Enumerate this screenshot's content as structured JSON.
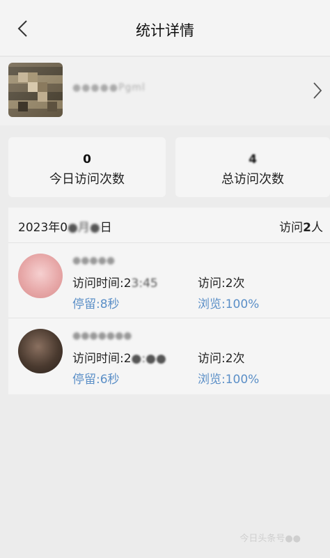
{
  "header": {
    "title": "统计详情",
    "back_icon": "chevron-left-icon"
  },
  "profile": {
    "name": "●●●●●Pgml",
    "forward_icon": "chevron-right-icon"
  },
  "stats": {
    "today": {
      "value": "0",
      "label": "今日访问次数"
    },
    "total": {
      "value": "4",
      "label": "总访问次数"
    }
  },
  "visits": {
    "date_prefix": "2023年0",
    "date_hidden": "●月●",
    "date_suffix": "日",
    "count_prefix": "访问",
    "count_value": "2",
    "count_suffix": "人",
    "items": [
      {
        "name": "●●●●●",
        "time_prefix": "访问时间:2",
        "time_hidden": "3:45",
        "stay": "停留:8秒",
        "visits": "访问:2次",
        "browse": "浏览:100%"
      },
      {
        "name": "●●●●●●●",
        "time_prefix": "访问时间:2",
        "time_hidden": "●:●●",
        "stay": "停留:6秒",
        "visits": "访问:2次",
        "browse": "浏览:100%"
      }
    ]
  },
  "watermark": "今日头条号●●",
  "colors": {
    "accent_blue": "#5b8fc7",
    "background": "#ececec",
    "card": "#f5f5f5"
  }
}
